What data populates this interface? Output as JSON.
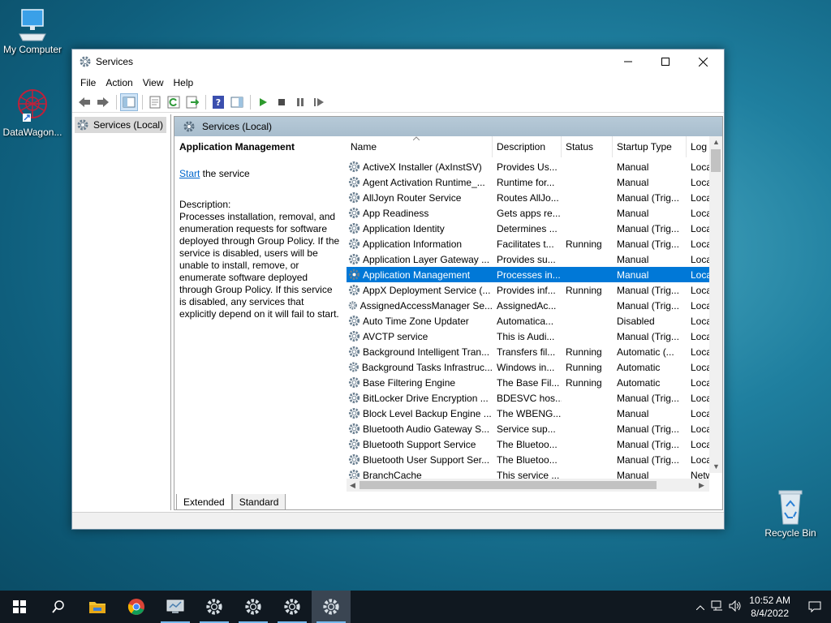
{
  "desktop": {
    "icons": [
      {
        "label": "My Computer"
      },
      {
        "label": "DataWagon..."
      },
      {
        "label": "Recycle Bin"
      }
    ]
  },
  "window": {
    "title": "Services",
    "menu": [
      "File",
      "Action",
      "View",
      "Help"
    ],
    "tree_item": "Services (Local)",
    "header": "Services (Local)",
    "selected_service": {
      "title": "Application Management",
      "start_link": "Start",
      "start_suffix": " the service",
      "description_label": "Description:",
      "description": "Processes installation, removal, and enumeration requests for software deployed through Group Policy. If the service is disabled, users will be unable to install, remove, or enumerate software deployed through Group Policy. If this service is disabled, any services that explicitly depend on it will fail to start."
    },
    "columns": [
      "Name",
      "Description",
      "Status",
      "Startup Type",
      "Log"
    ],
    "rows": [
      {
        "name": "ActiveX Installer (AxInstSV)",
        "description": "Provides Us...",
        "status": "",
        "startup": "Manual",
        "log": "Loca"
      },
      {
        "name": "Agent Activation Runtime_...",
        "description": "Runtime for...",
        "status": "",
        "startup": "Manual",
        "log": "Loca"
      },
      {
        "name": "AllJoyn Router Service",
        "description": "Routes AllJo...",
        "status": "",
        "startup": "Manual (Trig...",
        "log": "Loca"
      },
      {
        "name": "App Readiness",
        "description": "Gets apps re...",
        "status": "",
        "startup": "Manual",
        "log": "Loca"
      },
      {
        "name": "Application Identity",
        "description": "Determines ...",
        "status": "",
        "startup": "Manual (Trig...",
        "log": "Loca"
      },
      {
        "name": "Application Information",
        "description": "Facilitates t...",
        "status": "Running",
        "startup": "Manual (Trig...",
        "log": "Loca"
      },
      {
        "name": "Application Layer Gateway ...",
        "description": "Provides su...",
        "status": "",
        "startup": "Manual",
        "log": "Loca"
      },
      {
        "name": "Application Management",
        "description": "Processes in...",
        "status": "",
        "startup": "Manual",
        "log": "Loca"
      },
      {
        "name": "AppX Deployment Service (...",
        "description": "Provides inf...",
        "status": "Running",
        "startup": "Manual (Trig...",
        "log": "Loca"
      },
      {
        "name": "AssignedAccessManager Se...",
        "description": "AssignedAc...",
        "status": "",
        "startup": "Manual (Trig...",
        "log": "Loca"
      },
      {
        "name": "Auto Time Zone Updater",
        "description": "Automatica...",
        "status": "",
        "startup": "Disabled",
        "log": "Loca"
      },
      {
        "name": "AVCTP service",
        "description": "This is Audi...",
        "status": "",
        "startup": "Manual (Trig...",
        "log": "Loca"
      },
      {
        "name": "Background Intelligent Tran...",
        "description": "Transfers fil...",
        "status": "Running",
        "startup": "Automatic (...",
        "log": "Loca"
      },
      {
        "name": "Background Tasks Infrastruc...",
        "description": "Windows in...",
        "status": "Running",
        "startup": "Automatic",
        "log": "Loca"
      },
      {
        "name": "Base Filtering Engine",
        "description": "The Base Fil...",
        "status": "Running",
        "startup": "Automatic",
        "log": "Loca"
      },
      {
        "name": "BitLocker Drive Encryption ...",
        "description": "BDESVC hos...",
        "status": "",
        "startup": "Manual (Trig...",
        "log": "Loca"
      },
      {
        "name": "Block Level Backup Engine ...",
        "description": "The WBENG...",
        "status": "",
        "startup": "Manual",
        "log": "Loca"
      },
      {
        "name": "Bluetooth Audio Gateway S...",
        "description": "Service sup...",
        "status": "",
        "startup": "Manual (Trig...",
        "log": "Loca"
      },
      {
        "name": "Bluetooth Support Service",
        "description": "The Bluetoo...",
        "status": "",
        "startup": "Manual (Trig...",
        "log": "Loca"
      },
      {
        "name": "Bluetooth User Support Ser...",
        "description": "The Bluetoo...",
        "status": "",
        "startup": "Manual (Trig...",
        "log": "Loca"
      },
      {
        "name": "BranchCache",
        "description": "This service ...",
        "status": "",
        "startup": "Manual",
        "log": "Netw"
      }
    ],
    "selected_row_index": 7,
    "tabs": [
      "Extended",
      "Standard"
    ]
  },
  "taskbar": {
    "time": "10:52 AM",
    "date": "8/4/2022"
  },
  "colors": {
    "selection": "#0078d7",
    "link": "#0066cc",
    "header_bar": "#aec2d2"
  }
}
